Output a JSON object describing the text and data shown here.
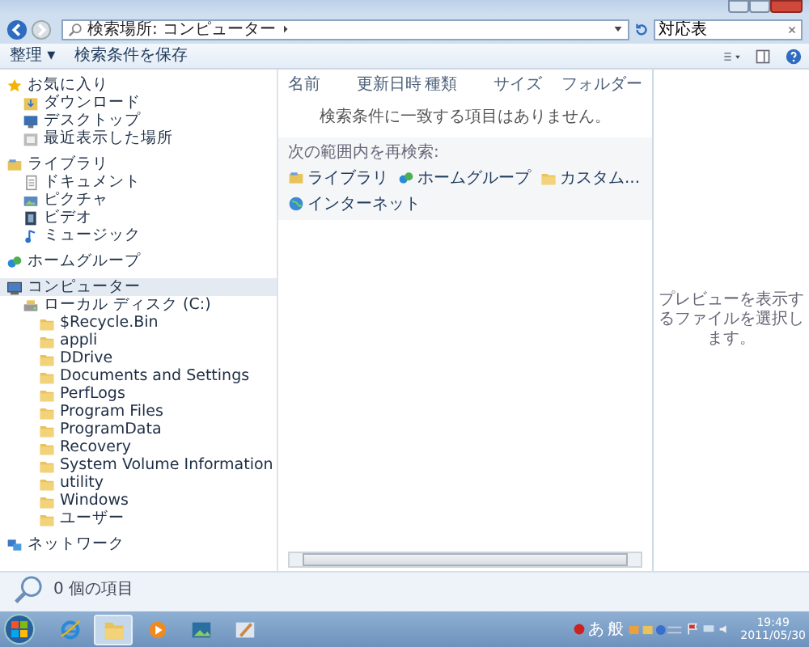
{
  "address_bar": {
    "path": "検索場所: コンピューター",
    "search_value": "対応表"
  },
  "toolbar": {
    "buttons": [
      "整理 ▾",
      "検索条件を保存"
    ]
  },
  "sidebar": {
    "groups": [
      {
        "label": "お気に入り",
        "selected": false,
        "children": [
          {
            "label": "ダウンロード",
            "selected": false
          },
          {
            "label": "デスクトップ",
            "selected": false
          },
          {
            "label": "最近表示した場所",
            "selected": false
          }
        ]
      },
      {
        "label": "ライブラリ",
        "selected": false,
        "children": [
          {
            "label": "ドキュメント",
            "selected": false
          },
          {
            "label": "ピクチャ",
            "selected": false
          },
          {
            "label": "ビデオ",
            "selected": false
          },
          {
            "label": "ミュージック",
            "selected": false
          }
        ]
      },
      {
        "label": "ホームグループ",
        "selected": false
      },
      {
        "label": "コンピューター",
        "selected": true,
        "children": [
          {
            "label": "ローカル ディスク (C:)",
            "selected": false,
            "children": [
              {
                "label": "$Recycle.Bin",
                "selected": false
              },
              {
                "label": "appli",
                "selected": false
              },
              {
                "label": "DDrive",
                "selected": false
              },
              {
                "label": "Documents and Settings",
                "selected": false
              },
              {
                "label": "PerfLogs",
                "selected": false
              },
              {
                "label": "Program Files",
                "selected": false
              },
              {
                "label": "ProgramData",
                "selected": false
              },
              {
                "label": "Recovery",
                "selected": false
              },
              {
                "label": "System Volume Information",
                "selected": false
              },
              {
                "label": "utility",
                "selected": false
              },
              {
                "label": "Windows",
                "selected": false
              },
              {
                "label": "ユーザー",
                "selected": false
              }
            ]
          }
        ]
      },
      {
        "label": "ネットワーク",
        "selected": false
      }
    ]
  },
  "content": {
    "columns": [
      "名前",
      "更新日時",
      "種類",
      "サイズ",
      "フォルダー"
    ],
    "empty_message": "検索条件に一致する項目はありません。",
    "search_again_label": "次の範囲内を再検索:",
    "search_again": [
      "ライブラリ",
      "ホームグループ",
      "カスタム...",
      "インターネット"
    ]
  },
  "preview": {
    "message": "プレビューを表示するファイルを選択します。"
  },
  "status_bar": {
    "text": "0 個の項目"
  },
  "taskbar": {
    "apps": [
      {
        "selected": false
      },
      {
        "selected": true
      },
      {
        "selected": false
      },
      {
        "selected": false
      },
      {
        "selected": false
      }
    ],
    "ime": [
      "あ",
      "般"
    ],
    "time": "19:49",
    "date": "2011/05/30"
  }
}
